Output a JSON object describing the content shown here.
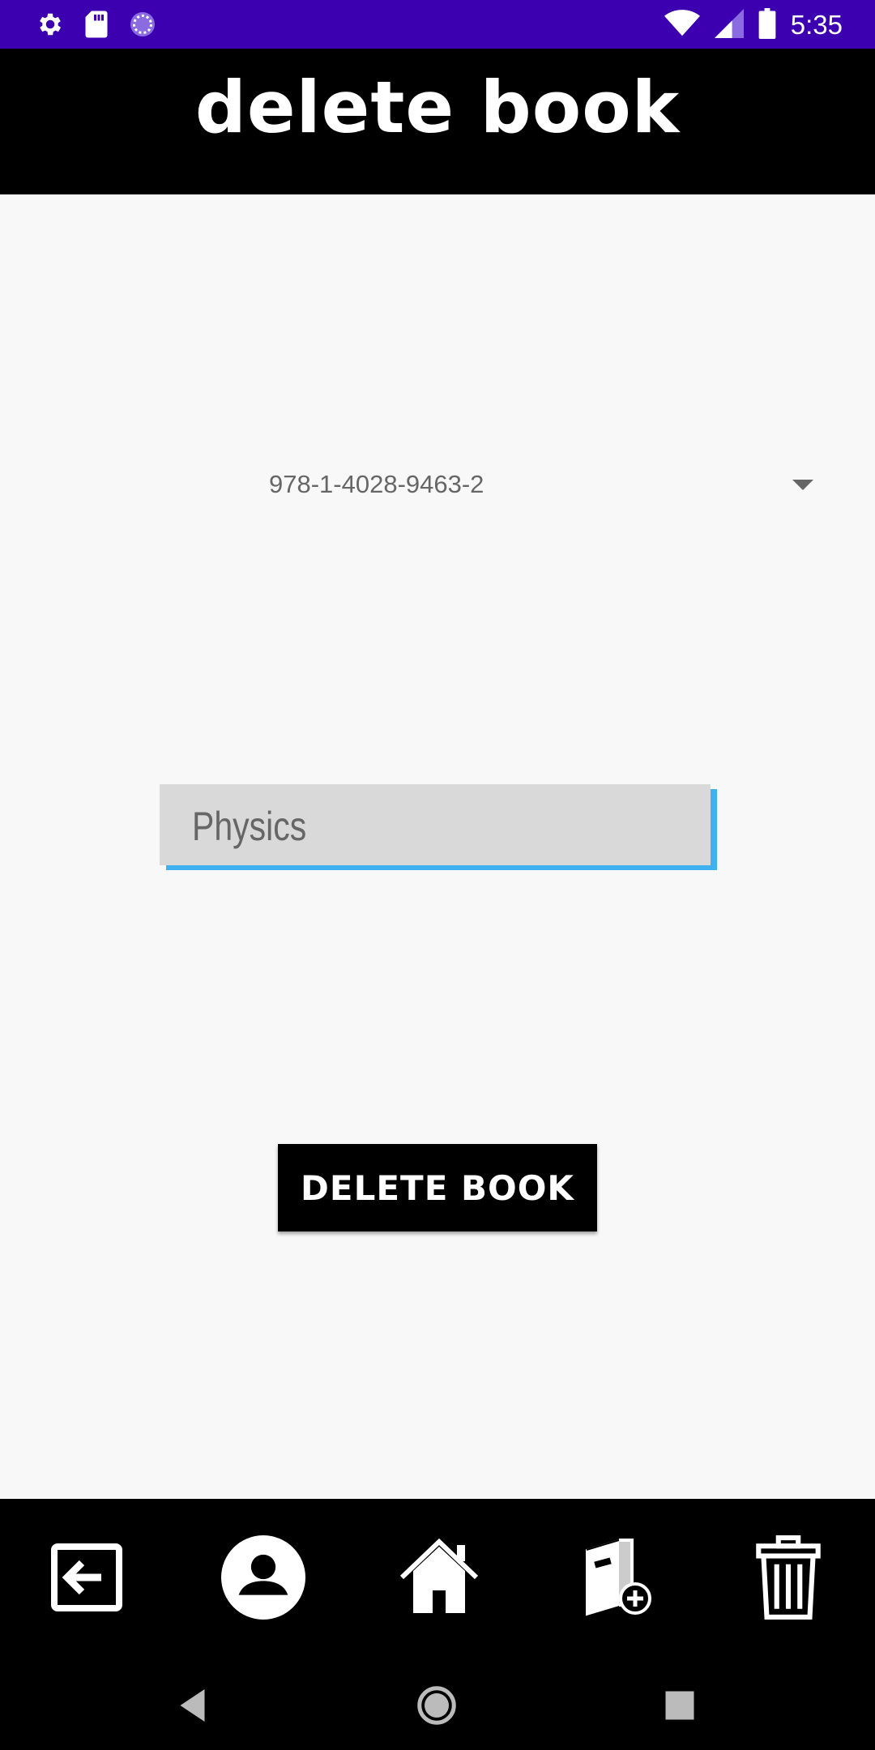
{
  "status_bar": {
    "time": "5:35",
    "icons": [
      "settings-icon",
      "sd-card-icon",
      "sync-icon",
      "wifi-icon",
      "signal-icon",
      "battery-icon"
    ],
    "background": "#3d00b1"
  },
  "header": {
    "title": "delete book",
    "background": "#000000"
  },
  "form": {
    "isbn_select": {
      "selected": "978-1-4028-9463-2"
    },
    "subject_field": {
      "value": "Physics"
    },
    "delete_button_label": "DELETE BOOK"
  },
  "bottom_nav": {
    "items": [
      {
        "icon": "exit-icon"
      },
      {
        "icon": "account-icon"
      },
      {
        "icon": "home-icon"
      },
      {
        "icon": "add-book-icon"
      },
      {
        "icon": "trash-icon"
      }
    ]
  },
  "system_nav": {
    "buttons": [
      "back-icon",
      "home-circle-icon",
      "recents-icon"
    ]
  },
  "colors": {
    "accent_blue": "#3fb0f0",
    "field_bg": "#d9d9d9",
    "page_bg": "#f8f8f8"
  }
}
